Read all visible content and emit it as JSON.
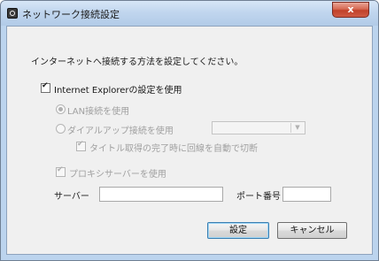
{
  "window": {
    "title": "ネットワーク接続設定",
    "close_glyph": "x"
  },
  "dialog": {
    "instruction": "インターネットへ接続する方法を設定してください。",
    "use_ie_settings": {
      "label": "Internet Explorerの設定を使用",
      "checked": true
    },
    "lan": {
      "label": "LAN接続を使用",
      "selected": true,
      "enabled": false
    },
    "dialup": {
      "label": "ダイアルアップ接続を使用",
      "selected": false,
      "enabled": false,
      "selected_value": ""
    },
    "auto_disconnect": {
      "label": "タイトル取得の完了時に回線を自動で切断",
      "checked": true,
      "enabled": false
    },
    "use_proxy": {
      "label": "プロキシサーバーを使用",
      "checked": true,
      "enabled": false
    },
    "server": {
      "label": "サーバー",
      "value": ""
    },
    "port": {
      "label": "ポート番号",
      "value": ""
    },
    "buttons": {
      "ok": "設定",
      "cancel": "キャンセル"
    }
  },
  "colors": {
    "titlebar": "#c1d6ee",
    "close_button": "#c1412a",
    "client_bg": "#f0f0f0"
  },
  "icons": {
    "app": "network-app-icon",
    "close": "close-icon",
    "dropdown": "chevron-down-icon"
  }
}
